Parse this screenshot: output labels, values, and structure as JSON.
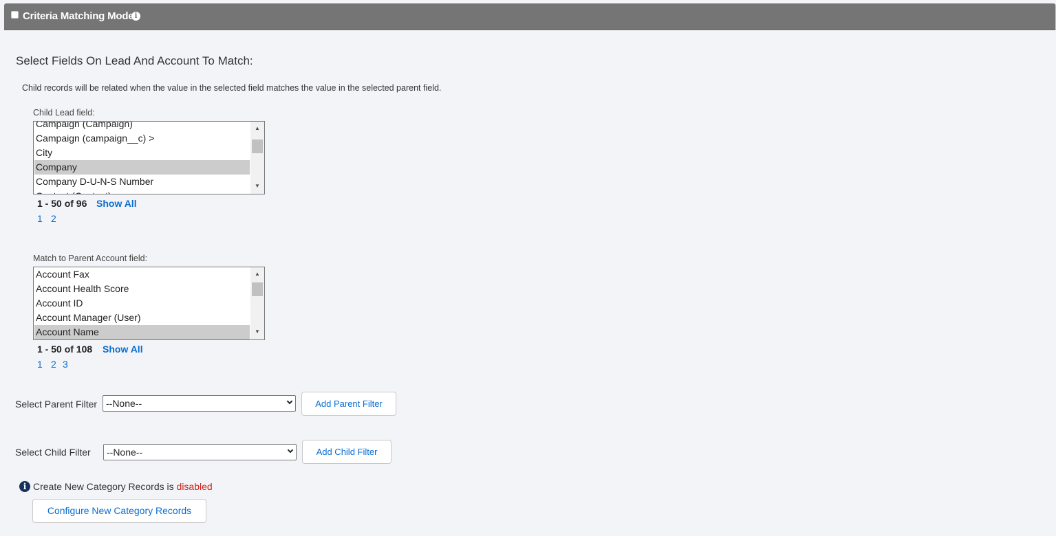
{
  "header": {
    "title": "Criteria Matching Mode",
    "checkbox_checked": false,
    "info_icon": "info-circle-icon"
  },
  "section": {
    "title": "Select Fields On Lead And Account To Match:",
    "description": "Child records will be related when the value in the selected field matches the value in the selected parent field."
  },
  "child_field": {
    "label": "Child Lead field:",
    "items": [
      "Campaign (Campaign)",
      "Campaign (campaign__c) >",
      "City",
      "Company",
      "Company D-U-N-S Number",
      "Contact (Contact)"
    ],
    "selected": "Company",
    "pager": {
      "count": "1 - 50 of 96",
      "show_all": "Show All",
      "pages": [
        "1",
        "2"
      ]
    }
  },
  "parent_field": {
    "label": "Match to Parent Account field:",
    "items": [
      "Account Fax",
      "Account Health Score",
      "Account ID",
      "Account Manager (User)",
      "Account Name"
    ],
    "selected": "Account Name",
    "pager": {
      "count": "1 - 50 of 108",
      "show_all": "Show All",
      "pages": [
        "1",
        "2",
        "3"
      ]
    }
  },
  "parent_filter": {
    "label": "Select Parent Filter",
    "value": "--None--",
    "button": "Add Parent Filter"
  },
  "child_filter": {
    "label": "Select Child Filter",
    "value": "--None--",
    "button": "Add Child Filter"
  },
  "category": {
    "text": "Create New Category Records is",
    "status": "disabled",
    "status_color": "#d0201a",
    "button": "Configure New Category Records"
  },
  "colors": {
    "header_bg": "#757575",
    "link": "#0a6ed1",
    "selected_row": "#cccccc"
  }
}
